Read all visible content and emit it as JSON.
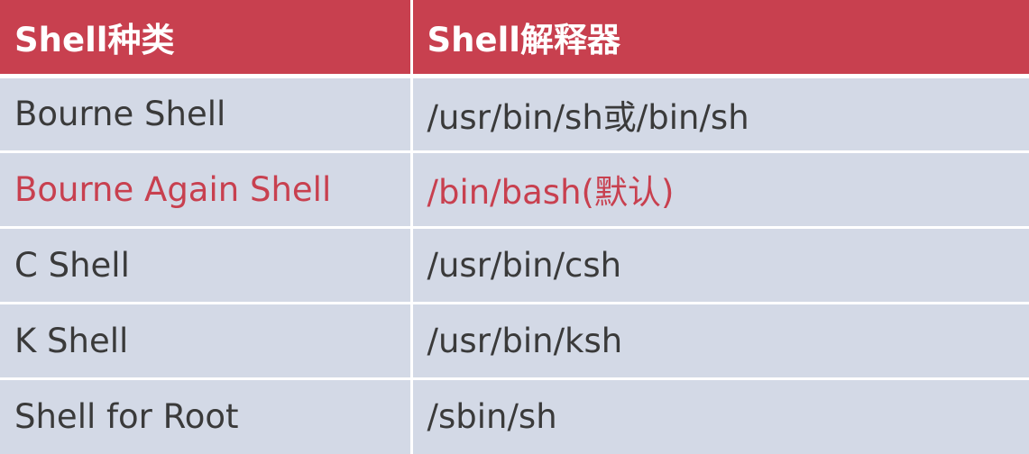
{
  "table": {
    "headers": [
      "Shell种类",
      "Shell解释器"
    ],
    "rows": [
      {
        "type": "Bourne Shell",
        "interpreter": "/usr/bin/sh或/bin/sh",
        "highlight": false
      },
      {
        "type": "Bourne Again Shell",
        "interpreter": "/bin/bash(默认)",
        "highlight": true
      },
      {
        "type": "C Shell",
        "interpreter": "/usr/bin/csh",
        "highlight": false
      },
      {
        "type": "K Shell",
        "interpreter": "/usr/bin/ksh",
        "highlight": false
      },
      {
        "type": "Shell for Root",
        "interpreter": "/sbin/sh",
        "highlight": false
      }
    ]
  },
  "colors": {
    "header_bg": "#c8404f",
    "header_text": "#ffffff",
    "row_bg": "#d3d9e6",
    "row_text": "#3a3a3a",
    "highlight_text": "#c8404f"
  }
}
